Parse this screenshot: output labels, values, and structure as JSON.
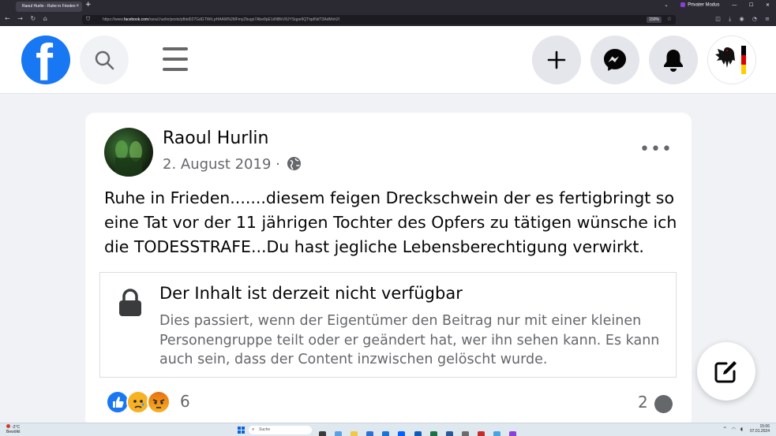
{
  "browser": {
    "tab_title": "Raoul Hurlin - Ruhe in Frieden",
    "tab_close": "×",
    "new_tab": "+",
    "private_label": "Privater Modus",
    "url_prefix": "https://www.",
    "url_domain": "facebook.com",
    "url_rest": "/raoul.hurlin/posts/pfbid027GdGTWrLpHAAWNJMFmyZbugs7Abe8pE1dNBkV8JYSqpe9QTtqdNdT3AdMvh2l",
    "zoom": "150%"
  },
  "header": {
    "logo_letter": "f"
  },
  "post": {
    "author": "Raoul Hurlin",
    "date": "2. August 2019 ·",
    "more": "•••",
    "text": "Ruhe in Frieden.......diesem feigen Dreckschwein der es fertigbringt so eine Tat vor der 11 jährigen Tochter des Opfers zu tätigen wünsche ich die TODESSTRAFE...Du hast jegliche Lebensberechtigung verwirkt.",
    "unavailable": {
      "title": "Der Inhalt ist derzeit nicht verfügbar",
      "description": "Dies passiert, wenn der Eigentümer den Beitrag nur mit einer kleinen Personengruppe teilt oder er geändert hat, wer ihn sehen kann. Es kann auch sein, dass der Content inzwischen gelöscht wurde."
    },
    "reaction_count": "6",
    "comment_count": "2"
  },
  "taskbar": {
    "weather_temp": "-2°C",
    "weather_desc": "Bewölkt",
    "search_placeholder": "Suche",
    "time": "15:06",
    "date": "07.01.2024"
  },
  "colors": {
    "facebook_blue": "#1877f2",
    "secondary_text": "#65676b",
    "browser_chrome": "#2b2a33"
  }
}
